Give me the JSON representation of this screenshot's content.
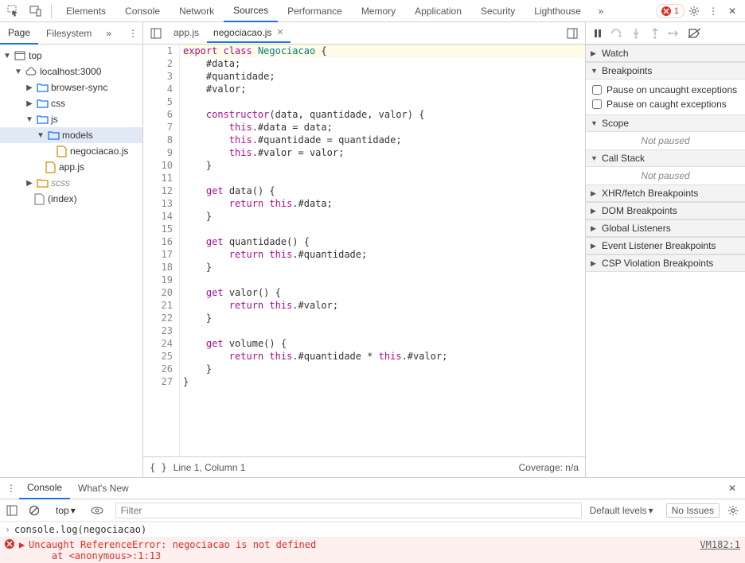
{
  "toolbar": {
    "tabs": [
      "Elements",
      "Console",
      "Network",
      "Sources",
      "Performance",
      "Memory",
      "Application",
      "Security",
      "Lighthouse"
    ],
    "activeTab": "Sources",
    "errorCount": "1"
  },
  "navigator": {
    "tabs": [
      "Page",
      "Filesystem"
    ],
    "activeTab": "Page",
    "tree": {
      "root": "top",
      "origin": "localhost:3000",
      "folders": [
        "browser-sync",
        "css",
        "js"
      ],
      "jsChildren": {
        "folder": "models",
        "files": [
          "negociacao.js"
        ]
      },
      "jsFiles": [
        "app.js"
      ],
      "scss": "scss",
      "index": "(index)"
    }
  },
  "editor": {
    "files": [
      "app.js",
      "negociacao.js"
    ],
    "activeFile": "negociacao.js",
    "lines": [
      "export class Negociacao {",
      "    #data;",
      "    #quantidade;",
      "    #valor;",
      "",
      "    constructor(data, quantidade, valor) {",
      "        this.#data = data;",
      "        this.#quantidade = quantidade;",
      "        this.#valor = valor;",
      "    }",
      "",
      "    get data() {",
      "        return this.#data;",
      "    }",
      "",
      "    get quantidade() {",
      "        return this.#quantidade;",
      "    }",
      "",
      "    get valor() {",
      "        return this.#valor;",
      "    }",
      "",
      "    get volume() {",
      "        return this.#quantidade * this.#valor;",
      "    }",
      "}"
    ],
    "status": {
      "position": "Line 1, Column 1",
      "coverage": "Coverage: n/a"
    }
  },
  "debugger": {
    "sections": [
      "Watch",
      "Breakpoints",
      "Scope",
      "Call Stack",
      "XHR/fetch Breakpoints",
      "DOM Breakpoints",
      "Global Listeners",
      "Event Listener Breakpoints",
      "CSP Violation Breakpoints"
    ],
    "breakpoints": {
      "uncaught": "Pause on uncaught exceptions",
      "caught": "Pause on caught exceptions"
    },
    "notPaused": "Not paused"
  },
  "drawer": {
    "tabs": [
      "Console",
      "What's New"
    ],
    "activeTab": "Console"
  },
  "console": {
    "context": "top",
    "filterPlaceholder": "Filter",
    "levels": "Default levels",
    "issues": "No Issues",
    "input": "console.log(negociacao)",
    "error": "Uncaught ReferenceError: negociacao is not defined\n    at <anonymous>:1:13",
    "errorSource": "VM182:1"
  }
}
